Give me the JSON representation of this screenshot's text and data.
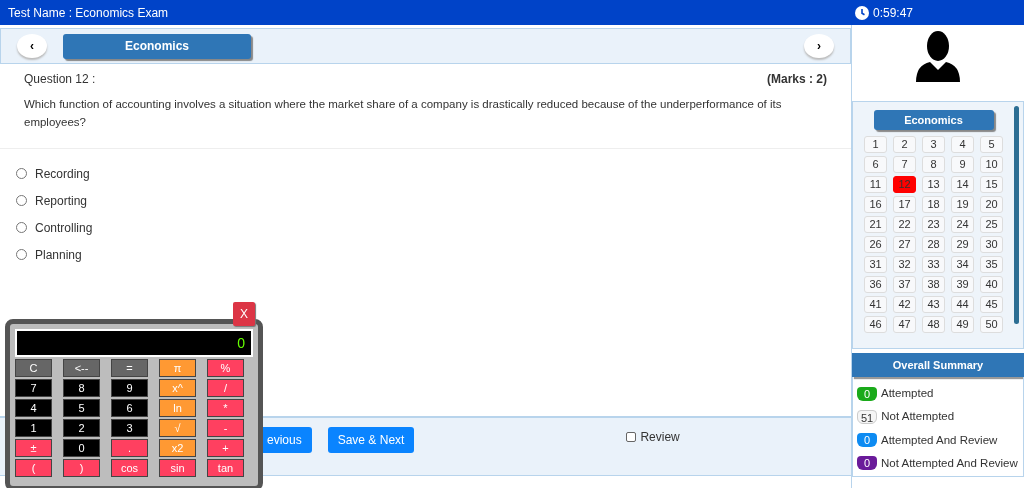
{
  "header": {
    "test_name": "Test Name : Economics Exam",
    "timer": "0:59:47"
  },
  "section_nav": {
    "prev": "‹",
    "section": "Economics",
    "next": "›"
  },
  "question": {
    "number": "Question 12 :",
    "marks": "(Marks : 2)",
    "text": "Which function of accounting involves a situation where the market share of a company is drastically reduced because of the underperformance of its employees?"
  },
  "options": [
    {
      "label": "Recording",
      "selected": false
    },
    {
      "label": "Reporting",
      "selected": false
    },
    {
      "label": "Controlling",
      "selected": false
    },
    {
      "label": "Planning",
      "selected": false
    }
  ],
  "actions": {
    "previous": "evious",
    "save_next": "Save & Next",
    "review": {
      "label": "Review",
      "checked": false
    }
  },
  "calculator": {
    "close": "X",
    "display": "0",
    "keys": [
      {
        "label": "C",
        "kind": "function"
      },
      {
        "label": "<--",
        "kind": "function"
      },
      {
        "label": "=",
        "kind": "function"
      },
      {
        "label": "π",
        "kind": "scientific"
      },
      {
        "label": "%",
        "kind": "operator"
      },
      {
        "label": "7",
        "kind": "digit"
      },
      {
        "label": "8",
        "kind": "digit"
      },
      {
        "label": "9",
        "kind": "digit"
      },
      {
        "label": "x^",
        "kind": "scientific"
      },
      {
        "label": "/",
        "kind": "operator"
      },
      {
        "label": "4",
        "kind": "digit"
      },
      {
        "label": "5",
        "kind": "digit"
      },
      {
        "label": "6",
        "kind": "digit"
      },
      {
        "label": "ln",
        "kind": "scientific"
      },
      {
        "label": "*",
        "kind": "operator"
      },
      {
        "label": "1",
        "kind": "digit"
      },
      {
        "label": "2",
        "kind": "digit"
      },
      {
        "label": "3",
        "kind": "digit"
      },
      {
        "label": "√",
        "kind": "scientific"
      },
      {
        "label": "-",
        "kind": "operator"
      },
      {
        "label": "±",
        "kind": "operator"
      },
      {
        "label": "0",
        "kind": "digit"
      },
      {
        "label": ".",
        "kind": "operator"
      },
      {
        "label": "x2",
        "kind": "scientific"
      },
      {
        "label": "+",
        "kind": "operator"
      },
      {
        "label": "(",
        "kind": "operator"
      },
      {
        "label": ")",
        "kind": "operator"
      },
      {
        "label": "cos",
        "kind": "operator"
      },
      {
        "label": "sin",
        "kind": "operator"
      },
      {
        "label": "tan",
        "kind": "operator"
      }
    ]
  },
  "palette": {
    "section": "Economics",
    "questions": [
      {
        "label": "1",
        "selected": false
      },
      {
        "label": "2",
        "selected": false
      },
      {
        "label": "3",
        "selected": false
      },
      {
        "label": "4",
        "selected": false
      },
      {
        "label": "5",
        "selected": false
      },
      {
        "label": "6",
        "selected": false
      },
      {
        "label": "7",
        "selected": false
      },
      {
        "label": "8",
        "selected": false
      },
      {
        "label": "9",
        "selected": false
      },
      {
        "label": "10",
        "selected": false
      },
      {
        "label": "11",
        "selected": false
      },
      {
        "label": "12",
        "selected": true
      },
      {
        "label": "13",
        "selected": false
      },
      {
        "label": "14",
        "selected": false
      },
      {
        "label": "15",
        "selected": false
      },
      {
        "label": "16",
        "selected": false
      },
      {
        "label": "17",
        "selected": false
      },
      {
        "label": "18",
        "selected": false
      },
      {
        "label": "19",
        "selected": false
      },
      {
        "label": "20",
        "selected": false
      },
      {
        "label": "21",
        "selected": false
      },
      {
        "label": "22",
        "selected": false
      },
      {
        "label": "23",
        "selected": false
      },
      {
        "label": "24",
        "selected": false
      },
      {
        "label": "25",
        "selected": false
      },
      {
        "label": "26",
        "selected": false
      },
      {
        "label": "27",
        "selected": false
      },
      {
        "label": "28",
        "selected": false
      },
      {
        "label": "29",
        "selected": false
      },
      {
        "label": "30",
        "selected": false
      },
      {
        "label": "31",
        "selected": false
      },
      {
        "label": "32",
        "selected": false
      },
      {
        "label": "33",
        "selected": false
      },
      {
        "label": "34",
        "selected": false
      },
      {
        "label": "35",
        "selected": false
      },
      {
        "label": "36",
        "selected": false
      },
      {
        "label": "37",
        "selected": false
      },
      {
        "label": "38",
        "selected": false
      },
      {
        "label": "39",
        "selected": false
      },
      {
        "label": "40",
        "selected": false
      },
      {
        "label": "41",
        "selected": false
      },
      {
        "label": "42",
        "selected": false
      },
      {
        "label": "43",
        "selected": false
      },
      {
        "label": "44",
        "selected": false
      },
      {
        "label": "45",
        "selected": false
      },
      {
        "label": "46",
        "selected": false
      },
      {
        "label": "47",
        "selected": false
      },
      {
        "label": "48",
        "selected": false
      },
      {
        "label": "49",
        "selected": false
      },
      {
        "label": "50",
        "selected": false
      }
    ]
  },
  "summary": {
    "title": "Overall Summary",
    "items": [
      {
        "count": "0",
        "label": "Attempted",
        "color": "#1aaa1a"
      },
      {
        "count": "51",
        "label": "Not Attempted",
        "color": "#f5f5f5"
      },
      {
        "count": "0",
        "label": "Attempted And Review",
        "color": "#0d8bf2"
      },
      {
        "count": "0",
        "label": "Not Attempted And Review",
        "color": "#6a1b9a"
      }
    ]
  }
}
